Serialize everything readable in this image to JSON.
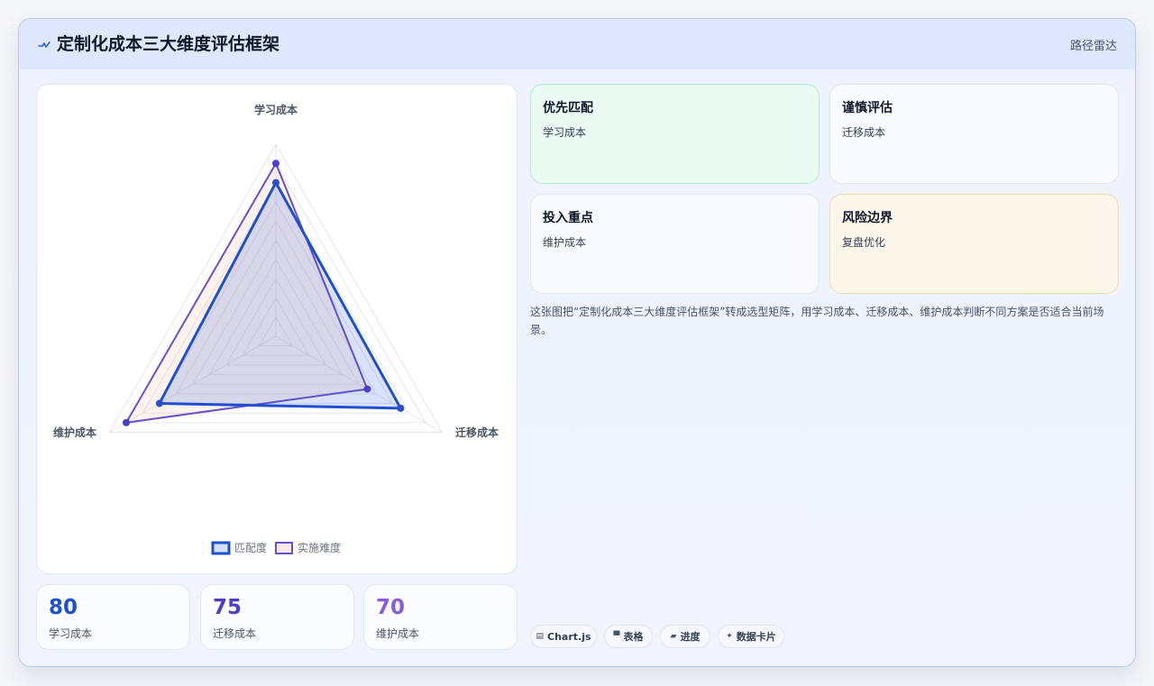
{
  "header": {
    "title": "定制化成本三大维度评估框架",
    "mode_label": "路径雷达"
  },
  "chart_data": {
    "type": "radar",
    "axes": [
      "学习成本",
      "迁移成本",
      "维护成本"
    ],
    "range": [
      0,
      100
    ],
    "series": [
      {
        "name": "匹配度",
        "values": [
          80,
          75,
          70
        ],
        "color": "#1f4fd1"
      },
      {
        "name": "实施难度",
        "values": [
          90,
          55,
          90
        ],
        "color": "#6a4fc9"
      }
    ],
    "legend_position": "bottom",
    "grid": true
  },
  "stats": [
    {
      "value": "80",
      "label": "学习成本",
      "color": "#1f4fd1"
    },
    {
      "value": "75",
      "label": "迁移成本",
      "color": "#4a3fc6"
    },
    {
      "value": "70",
      "label": "维护成本",
      "color": "#8a5cdb"
    }
  ],
  "quadrants": [
    {
      "title": "优先匹配",
      "value": "学习成本"
    },
    {
      "title": "谨慎评估",
      "value": "迁移成本"
    },
    {
      "title": "投入重点",
      "value": "维护成本"
    },
    {
      "title": "风险边界",
      "value": "复盘优化"
    }
  ],
  "description": "这张图把“定制化成本三大维度评估框架”转成选型矩阵，用学习成本、迁移成本、维护成本判断不同方案是否适合当前场景。",
  "tags": [
    {
      "icon": "▤",
      "label": "Chart.js"
    },
    {
      "icon": "▀",
      "label": "表格"
    },
    {
      "icon": "▰",
      "label": "进度"
    },
    {
      "icon": "✦",
      "label": "数据卡片"
    }
  ],
  "colors": {
    "accent": "#1f4fd1",
    "secondary": "#6a4fc9",
    "green_card": "#e9fbf3",
    "amber_card": "#fdf6ea"
  }
}
